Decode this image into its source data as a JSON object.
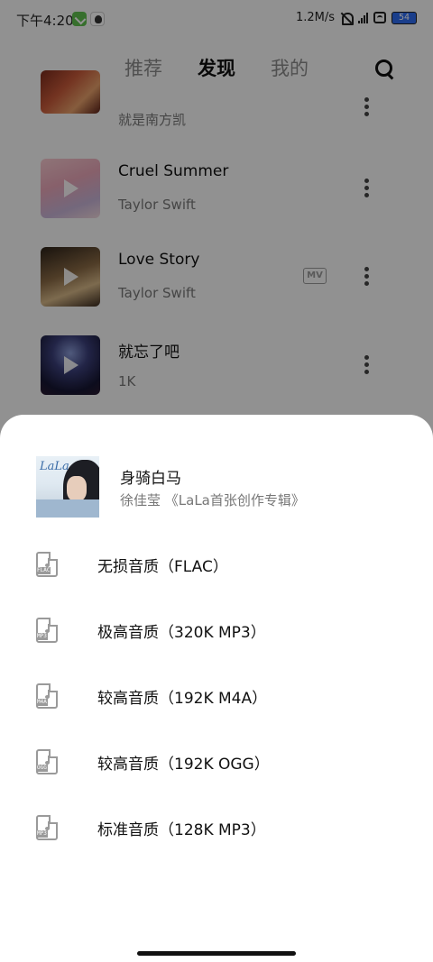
{
  "status_bar": {
    "time": "下午4:20",
    "net_speed": "1.2M/s",
    "battery": "54"
  },
  "top_nav": {
    "tabs": [
      "推荐",
      "发现",
      "我的"
    ],
    "active_tab": "发现"
  },
  "songs": [
    {
      "title": "",
      "artist": "就是南方凯",
      "has_mv": false
    },
    {
      "title": "Cruel Summer",
      "artist": "Taylor Swift",
      "has_mv": false
    },
    {
      "title": "Love Story",
      "artist": "Taylor Swift",
      "has_mv": true,
      "mv_label": "MV"
    },
    {
      "title": "就忘了吧",
      "artist": "1K",
      "has_mv": false
    }
  ],
  "sheet": {
    "song_title": "身骑白马",
    "subtitle": "徐佳莹 《LaLa首张创作专辑》",
    "cover_text": "LaLa",
    "qualities": [
      {
        "label": "无损音质（FLAC）",
        "ext": "FLAC"
      },
      {
        "label": "极高音质（320K MP3）",
        "ext": "MP3"
      },
      {
        "label": "较高音质（192K M4A）",
        "ext": "M4A"
      },
      {
        "label": "较高音质（192K OGG）",
        "ext": "OGG"
      },
      {
        "label": "标准音质（128K MP3）",
        "ext": "MP3"
      }
    ]
  }
}
